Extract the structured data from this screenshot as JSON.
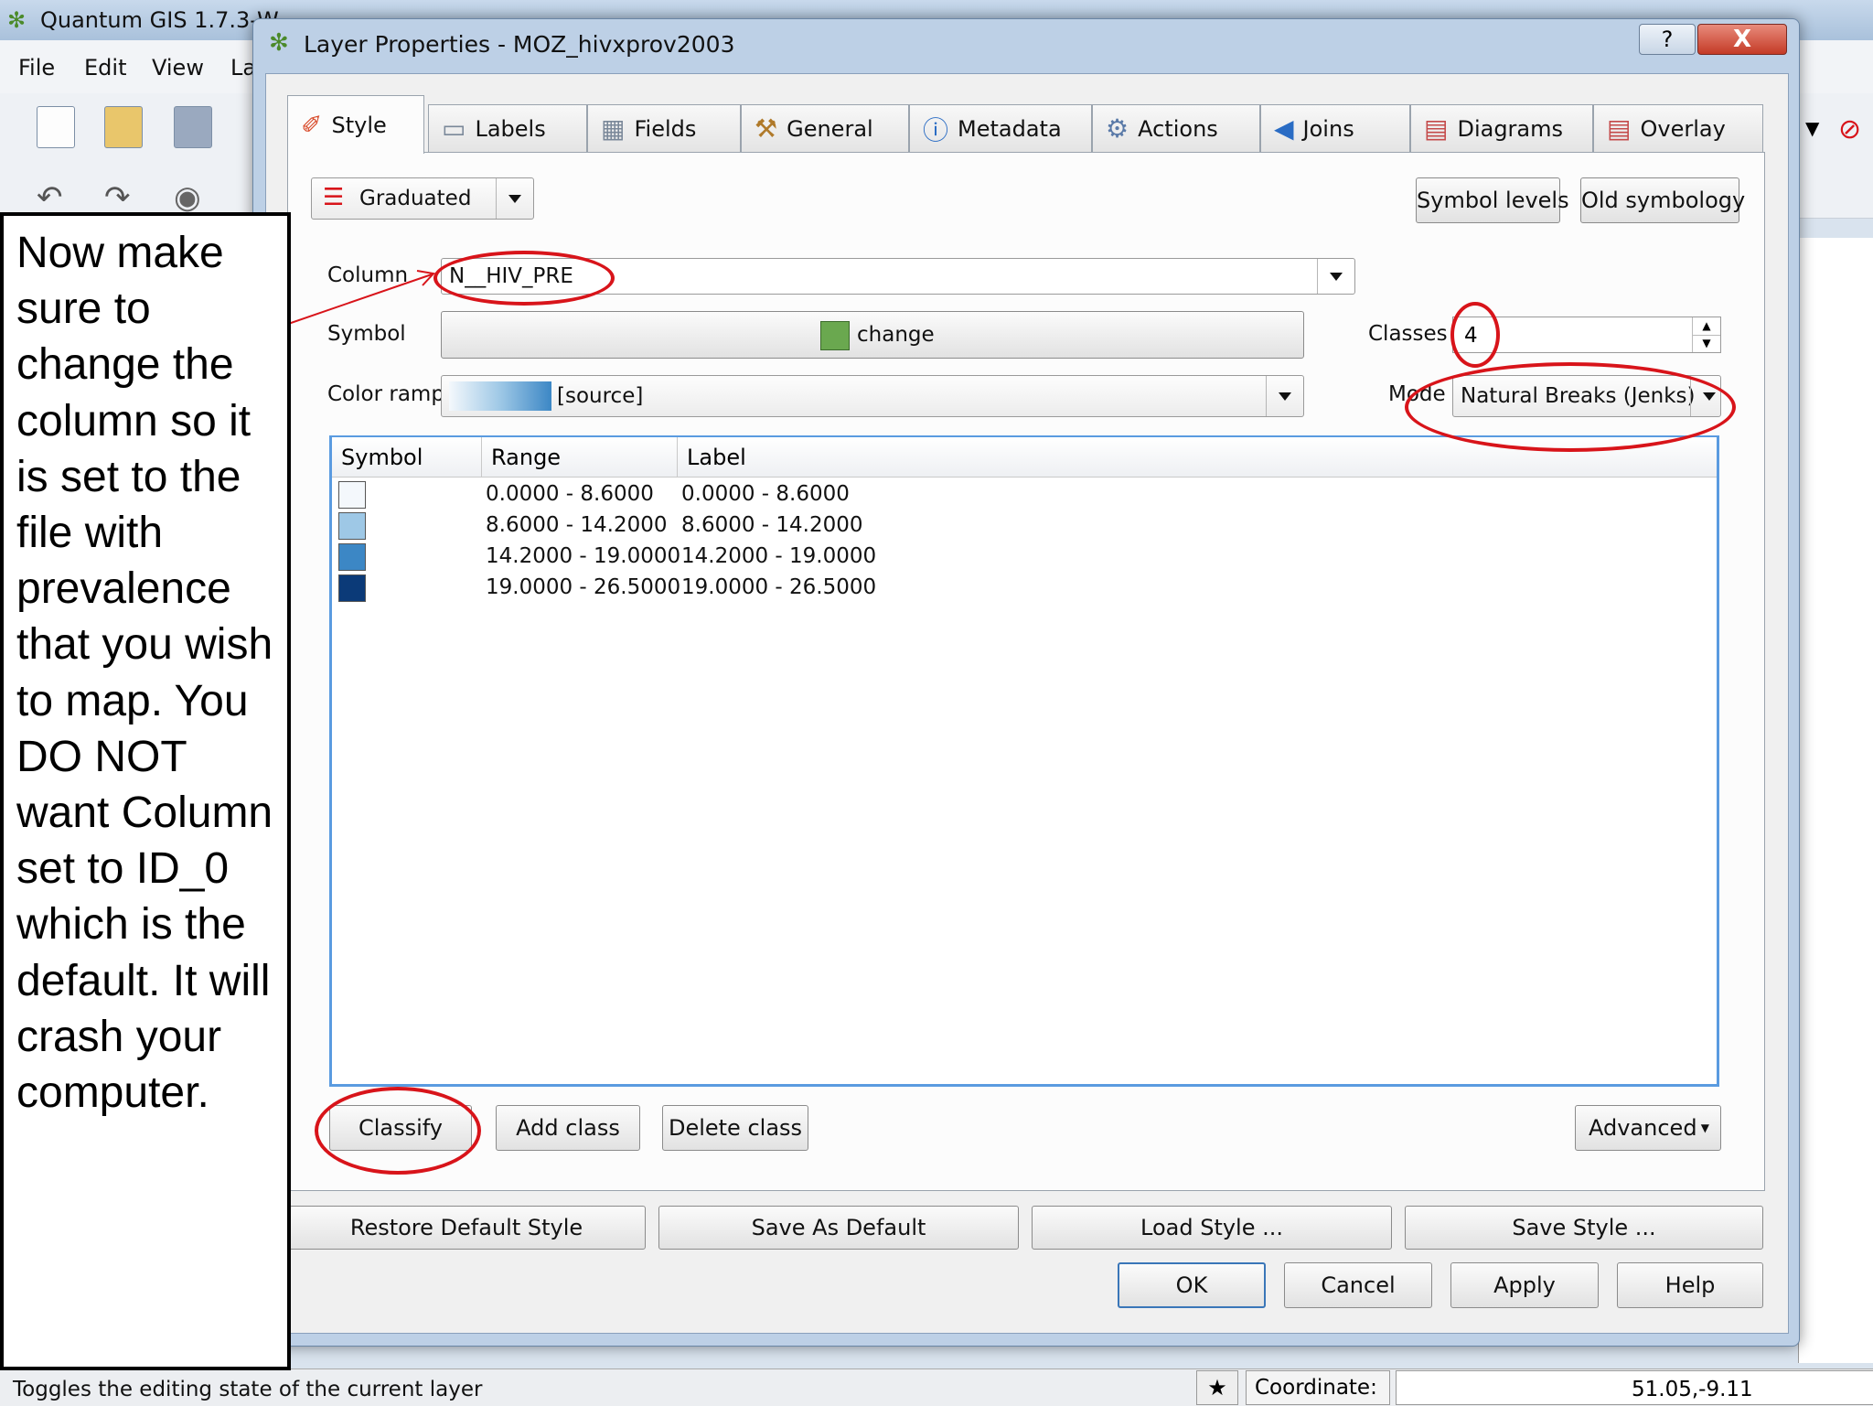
{
  "main_window": {
    "title": "Quantum GIS 1.7.3-W",
    "menu": [
      "File",
      "Edit",
      "View",
      "La"
    ],
    "status_text": "Toggles the editing state of the current layer",
    "coordinate_label": "Coordinate:",
    "coordinate_value": "51.05,-9.11"
  },
  "dialog": {
    "title": "Layer Properties - MOZ_hivxprov2003",
    "help_glyph": "?",
    "close_glyph": "X",
    "tabs": [
      {
        "label": "Style",
        "icon": "paint-brush-icon"
      },
      {
        "label": "Labels",
        "icon": "label-icon"
      },
      {
        "label": "Fields",
        "icon": "table-icon"
      },
      {
        "label": "General",
        "icon": "tools-icon"
      },
      {
        "label": "Metadata",
        "icon": "info-icon"
      },
      {
        "label": "Actions",
        "icon": "gears-icon"
      },
      {
        "label": "Joins",
        "icon": "join-icon"
      },
      {
        "label": "Diagrams",
        "icon": "diagram-icon"
      },
      {
        "label": "Overlay",
        "icon": "overlay-icon"
      }
    ],
    "renderer_type": "Graduated",
    "symbol_levels_label": "Symbol levels",
    "old_symbology_label": "Old symbology",
    "column_label": "Column",
    "column_value": "N__HIV_PRE",
    "symbol_label": "Symbol",
    "symbol_value": "change",
    "symbol_color": "#6aa84f",
    "classes_label": "Classes",
    "classes_value": "4",
    "color_ramp_label": "Color ramp",
    "color_ramp_value": "[source]",
    "mode_label": "Mode",
    "mode_value": "Natural Breaks (Jenks)",
    "table": {
      "headers": [
        "Symbol",
        "Range",
        "Label"
      ],
      "rows": [
        {
          "color": "#f4f8fc",
          "range": "0.0000 - 8.6000",
          "label": "0.0000 - 8.6000"
        },
        {
          "color": "#9ec8e6",
          "range": "8.6000 - 14.2000",
          "label": "8.6000 - 14.2000"
        },
        {
          "color": "#3c87c5",
          "range": "14.2000 - 19.0000",
          "label": "14.2000 - 19.0000"
        },
        {
          "color": "#0b3a78",
          "range": "19.0000 - 26.5000",
          "label": "19.0000 - 26.5000"
        }
      ]
    },
    "classify_label": "Classify",
    "add_class_label": "Add class",
    "delete_class_label": "Delete class",
    "advanced_label": "Advanced",
    "restore_default_label": "Restore Default Style",
    "save_default_label": "Save As Default",
    "load_style_label": "Load Style ...",
    "save_style_label": "Save Style ...",
    "ok_label": "OK",
    "cancel_label": "Cancel",
    "apply_label": "Apply",
    "help_label": "Help"
  },
  "annotation": {
    "text": "Now make sure to change the column so it is set to the file with prevalence that you wish to map. You DO NOT want Column set to ID_0 which is the default. It will crash your computer.",
    "highlight_color": "#d8141a"
  }
}
